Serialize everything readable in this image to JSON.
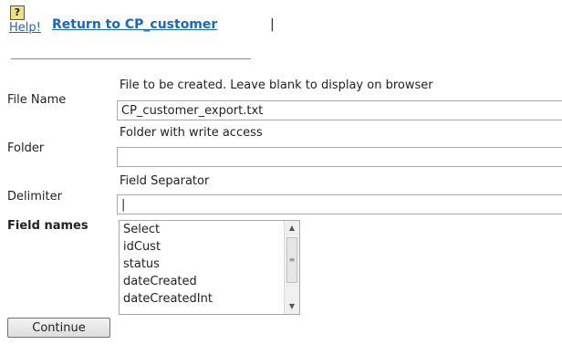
{
  "header": {
    "help_icon_glyph": "?",
    "help_label": "Help!",
    "return_label": "Return to CP_customer",
    "separator": "|"
  },
  "form": {
    "file_name": {
      "label": "File Name",
      "hint": "File to be created. Leave blank to display on browser",
      "value": "CP_customer_export.txt"
    },
    "folder": {
      "label": "Folder",
      "hint": "Folder with write access",
      "value": ""
    },
    "delimiter": {
      "label": "Delimiter",
      "hint": "Field Separator",
      "value": "|"
    },
    "field_names": {
      "label": "Field names",
      "options": [
        "Select",
        "idCust",
        "status",
        "dateCreated",
        "dateCreatedInt"
      ]
    },
    "continue_label": "Continue"
  },
  "icons": {
    "help": "help-icon",
    "scroll_up": "chevron-up-icon",
    "scroll_down": "chevron-down-icon"
  },
  "colors": {
    "link": "#1a66c7",
    "help_icon_bg": "#f0e08a"
  }
}
